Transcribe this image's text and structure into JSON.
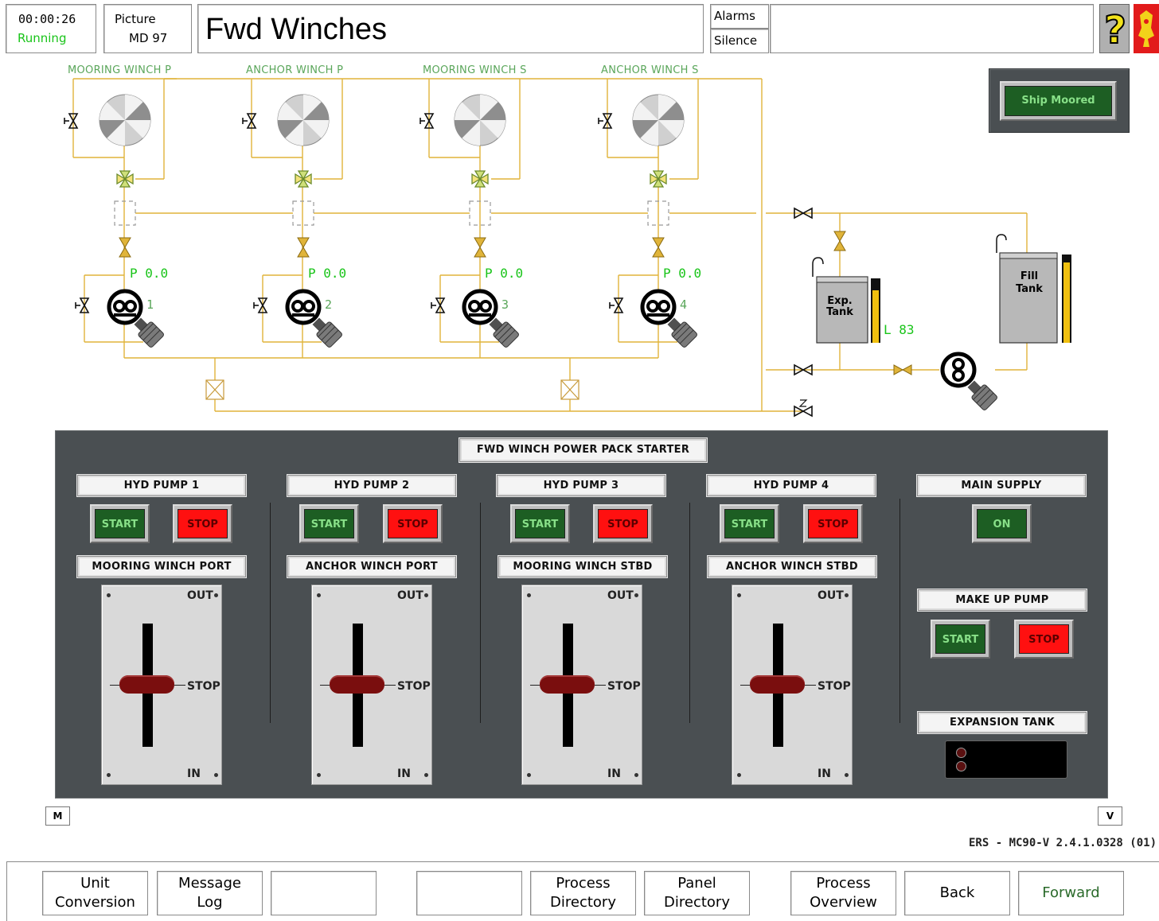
{
  "header": {
    "time": "00:00:26",
    "status": "Running",
    "picture_label": "Picture",
    "picture_id": "MD 97",
    "title": "Fwd Winches",
    "alarms_label": "Alarms",
    "silence_label": "Silence",
    "help_icon": "question-mark-icon",
    "logo_icon": "crest-logo"
  },
  "diagram": {
    "winch_labels": [
      "MOORING WINCH P",
      "ANCHOR WINCH P",
      "MOORING WINCH S",
      "ANCHOR WINCH S"
    ],
    "pressures": [
      "P 0.0",
      "P 0.0",
      "P 0.0",
      "P 0.0"
    ],
    "pump_numbers": [
      "1",
      "2",
      "3",
      "4"
    ],
    "exp_tank_label": "Exp.\nTank",
    "fill_tank_label": "Fill\nTank",
    "exp_tank_level": "L 83",
    "exp_tank_level_fraction": 0.83,
    "ship_moored_label": "Ship Moored",
    "colors": {
      "pipe": "#e0b43a",
      "status_green": "#19c419",
      "label_green": "#5aa65a"
    }
  },
  "panel": {
    "title": "FWD WINCH POWER PACK STARTER",
    "pumps": [
      {
        "label": "HYD PUMP 1",
        "start": "START",
        "stop": "STOP",
        "winch": "MOORING WINCH PORT",
        "out": "OUT",
        "stop_pos": "STOP",
        "in": "IN"
      },
      {
        "label": "HYD PUMP 2",
        "start": "START",
        "stop": "STOP",
        "winch": "ANCHOR WINCH PORT",
        "out": "OUT",
        "stop_pos": "STOP",
        "in": "IN"
      },
      {
        "label": "HYD PUMP 3",
        "start": "START",
        "stop": "STOP",
        "winch": "MOORING WINCH STBD",
        "out": "OUT",
        "stop_pos": "STOP",
        "in": "IN"
      },
      {
        "label": "HYD PUMP 4",
        "start": "START",
        "stop": "STOP",
        "winch": "ANCHOR WINCH STBD",
        "out": "OUT",
        "stop_pos": "STOP",
        "in": "IN"
      }
    ],
    "main_supply": {
      "label": "MAIN SUPPLY",
      "on": "ON"
    },
    "make_up_pump": {
      "label": "MAKE UP PUMP",
      "start": "START",
      "stop": "STOP"
    },
    "expansion_tank": {
      "label": "EXPANSION TANK"
    }
  },
  "side_buttons": {
    "m": "M",
    "v": "V"
  },
  "version": "ERS - MC90-V 2.4.1.0328 (01)",
  "footer": {
    "unit_conversion": "Unit\nConversion",
    "message_log": "Message\nLog",
    "blank1": "",
    "blank2": "",
    "process_directory": "Process\nDirectory",
    "panel_directory": "Panel\nDirectory",
    "process_overview": "Process\nOverview",
    "back": "Back",
    "forward": "Forward"
  }
}
